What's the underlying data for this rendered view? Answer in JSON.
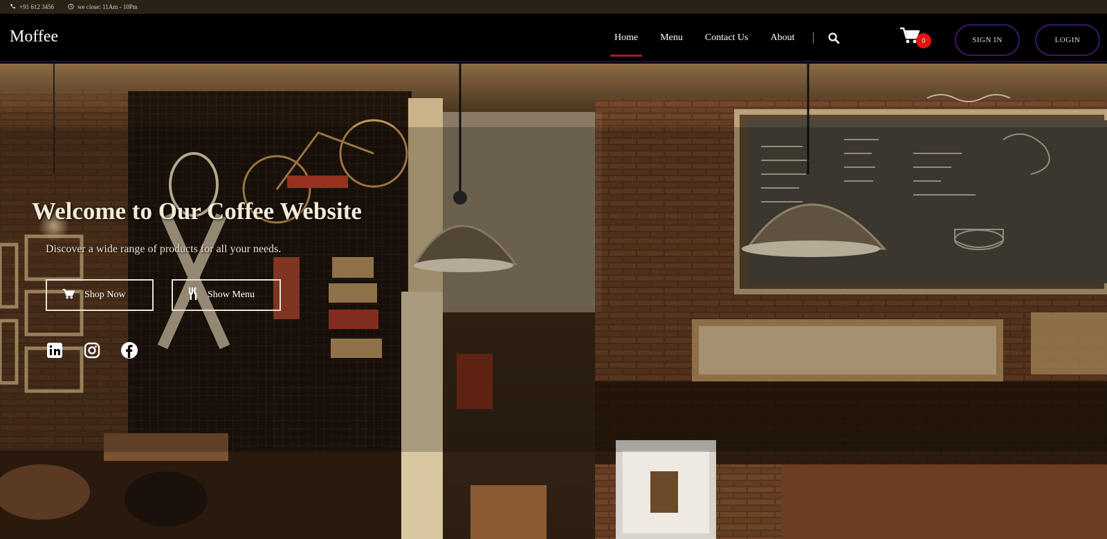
{
  "topbar": {
    "phone": "+91 612 3456",
    "hours": "we close: 11Am - 10Pm",
    "phone_icon": "phone-icon",
    "clock_icon": "clock-icon"
  },
  "nav": {
    "brand": "Moffee",
    "links": [
      "Home",
      "Menu",
      "Contact Us",
      "About"
    ],
    "active": "Home",
    "cart_count": "0",
    "signin_label": "SIGN IN",
    "login_label": "LOGIN"
  },
  "hero": {
    "title": "Welcome to Our Coffee Website",
    "subtitle": "Discover a wide range of products for all your needs.",
    "shop_label": "Shop Now",
    "menu_label": "Show Menu"
  },
  "socials": [
    "linkedin-icon",
    "instagram-icon",
    "facebook-icon"
  ],
  "colors": {
    "accent": "#a0193b",
    "badge": "#e41414",
    "button_border": "#3a1866"
  }
}
